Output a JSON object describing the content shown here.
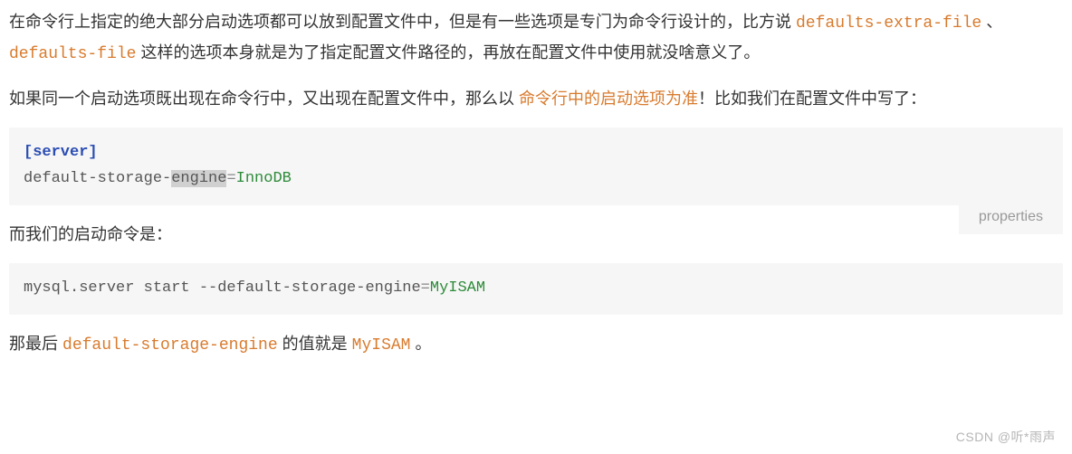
{
  "para1": {
    "t1": "在命令行上指定的绝大部分启动选项都可以放到配置文件中，但是有一些选项是专门为命令行设计的，比方说 ",
    "c1": "defaults-extra-file",
    "t2": " 、 ",
    "c2": "defaults-file",
    "t3": " 这样的选项本身就是为了指定配置文件路径的，再放在配置文件中使用就没啥意义了。"
  },
  "para2": {
    "t1": "如果同一个启动选项既出现在命令行中，又出现在配置文件中，那么以 ",
    "h1": "命令行中的启动选项为准",
    "t2": "！比如我们在配置文件中写了："
  },
  "code1": {
    "lang": "properties",
    "section": "[server]",
    "key_a": "default-storage-",
    "key_b": "engine",
    "eq": "=",
    "val": "InnoDB"
  },
  "para3": {
    "t1": "而我们的启动命令是："
  },
  "code2": {
    "cmd": "mysql.server start --default-storage-engine",
    "eq": "=",
    "val": "MyISAM"
  },
  "para4": {
    "t1": "那最后 ",
    "c1": "default-storage-engine",
    "t2": " 的值就是 ",
    "c2": "MyISAM",
    "t3": " 。"
  },
  "watermark": "CSDN @听*雨声"
}
